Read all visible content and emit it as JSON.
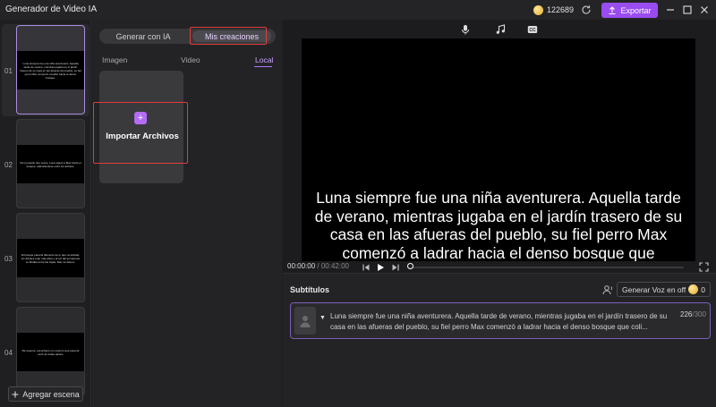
{
  "titlebar": {
    "app_title": "Generador de Video IA",
    "credits": "122689",
    "export_label": "Exportar"
  },
  "scenes": {
    "items": [
      {
        "number": "01",
        "caption": "Luna siempre fue una niña aventurera. Aquella tarde de verano, mientras jugaba en el jardín trasero de su casa en las afueras del pueblo, su fiel perro Max comenzó a ladrar hacia el denso bosque."
      },
      {
        "number": "02",
        "caption": "Sin pensarlo dos veces, Luna siguió a Max hacia el bosque, adentrándose entre los árboles."
      },
      {
        "number": "03",
        "caption": "El bosque parecía diferente de lo que recordaba, los árboles eran más altos y la luz del sol apenas se filtraba entre las hojas. Max se detuvo."
      },
      {
        "number": "04",
        "caption": "De repente, escucharon un susurro que parecía venir de todas partes."
      }
    ],
    "add_label": "Agregar escena"
  },
  "media_panel": {
    "tabs": [
      "Generar con IA",
      "Mis creaciones"
    ],
    "active_tab": "Mis creaciones",
    "subtabs": [
      "Imagen",
      "Video",
      "Local"
    ],
    "active_subtab": "Local",
    "import_label": "Importar Archivos"
  },
  "preview": {
    "caption": "Luna siempre fue una niña aventurera. Aquella tarde de verano, mientras jugaba en el jardín trasero de su casa en las afueras del pueblo, su fiel perro Max comenzó a ladrar hacia el denso bosque que colindaba con su propiedad",
    "current_time": "00:00:00",
    "total_time": "/ 00:42:00",
    "playhead_fraction": 0
  },
  "subtitles": {
    "title": "Subtítulos",
    "generate_voice_label": "Generar Voz en off",
    "voice_credits": "0",
    "row_text": "Luna siempre fue una niña aventurera. Aquella tarde de verano, mientras jugaba en el jardín trasero de su casa en las afueras del pueblo, su fiel perro Max comenzó a ladrar hacia el denso bosque que coli...",
    "char_count": "226",
    "char_limit": "/300"
  },
  "colors": {
    "accent": "#9a4cf0",
    "highlight_box": "#e23b3b",
    "background": "#1e1e1f"
  }
}
